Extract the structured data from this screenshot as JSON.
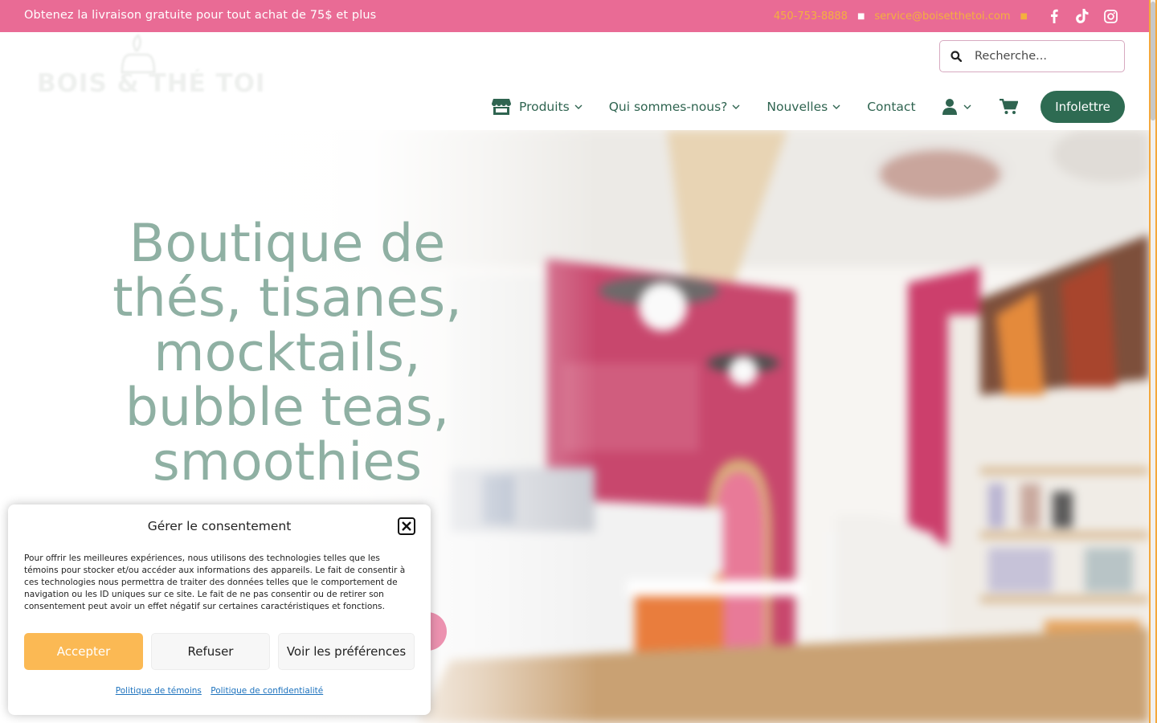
{
  "topbar": {
    "promo": "Obtenez la livraison gratuite pour tout achat de 75$ et plus",
    "phone": "450-753-8888",
    "email": "service@boisetthetoi.com",
    "social": [
      "facebook-icon",
      "tiktok-icon",
      "instagram-icon"
    ],
    "bg_color": "#e96b95",
    "accent_color": "#f4b03e"
  },
  "header": {
    "logo_text": "BOIS & THÉ TOI",
    "search_placeholder": "Recherche...",
    "nav": [
      {
        "label": "Produits",
        "icon": "store-icon",
        "dropdown": true
      },
      {
        "label": "Qui sommes-nous?",
        "dropdown": true
      },
      {
        "label": "Nouvelles",
        "dropdown": true
      },
      {
        "label": "Contact",
        "dropdown": false
      }
    ],
    "account_icon": "user-icon",
    "cart_icon": "cart-icon",
    "cta_label": "Infolettre",
    "brand_color": "#2e6b52"
  },
  "hero": {
    "title": "Boutique de thés, tisanes, mocktails, bubble teas, smoothies",
    "title_color": "#8fb0a3"
  },
  "consent": {
    "title": "Gérer le consentement",
    "body": "Pour offrir les meilleures expériences, nous utilisons des technologies telles que les témoins pour stocker et/ou accéder aux informations des appareils. Le fait de consentir à ces technologies nous permettra de traiter des données telles que le comportement de navigation ou les ID uniques sur ce site. Le fait de ne pas consentir ou de retirer son consentement peut avoir un effet négatif sur certaines caractéristiques et fonctions.",
    "accept": "Accepter",
    "refuse": "Refuser",
    "preferences": "Voir les préférences",
    "links": [
      "Politique de témoins",
      "Politique de confidentialité"
    ],
    "accept_color": "#fbb954"
  }
}
